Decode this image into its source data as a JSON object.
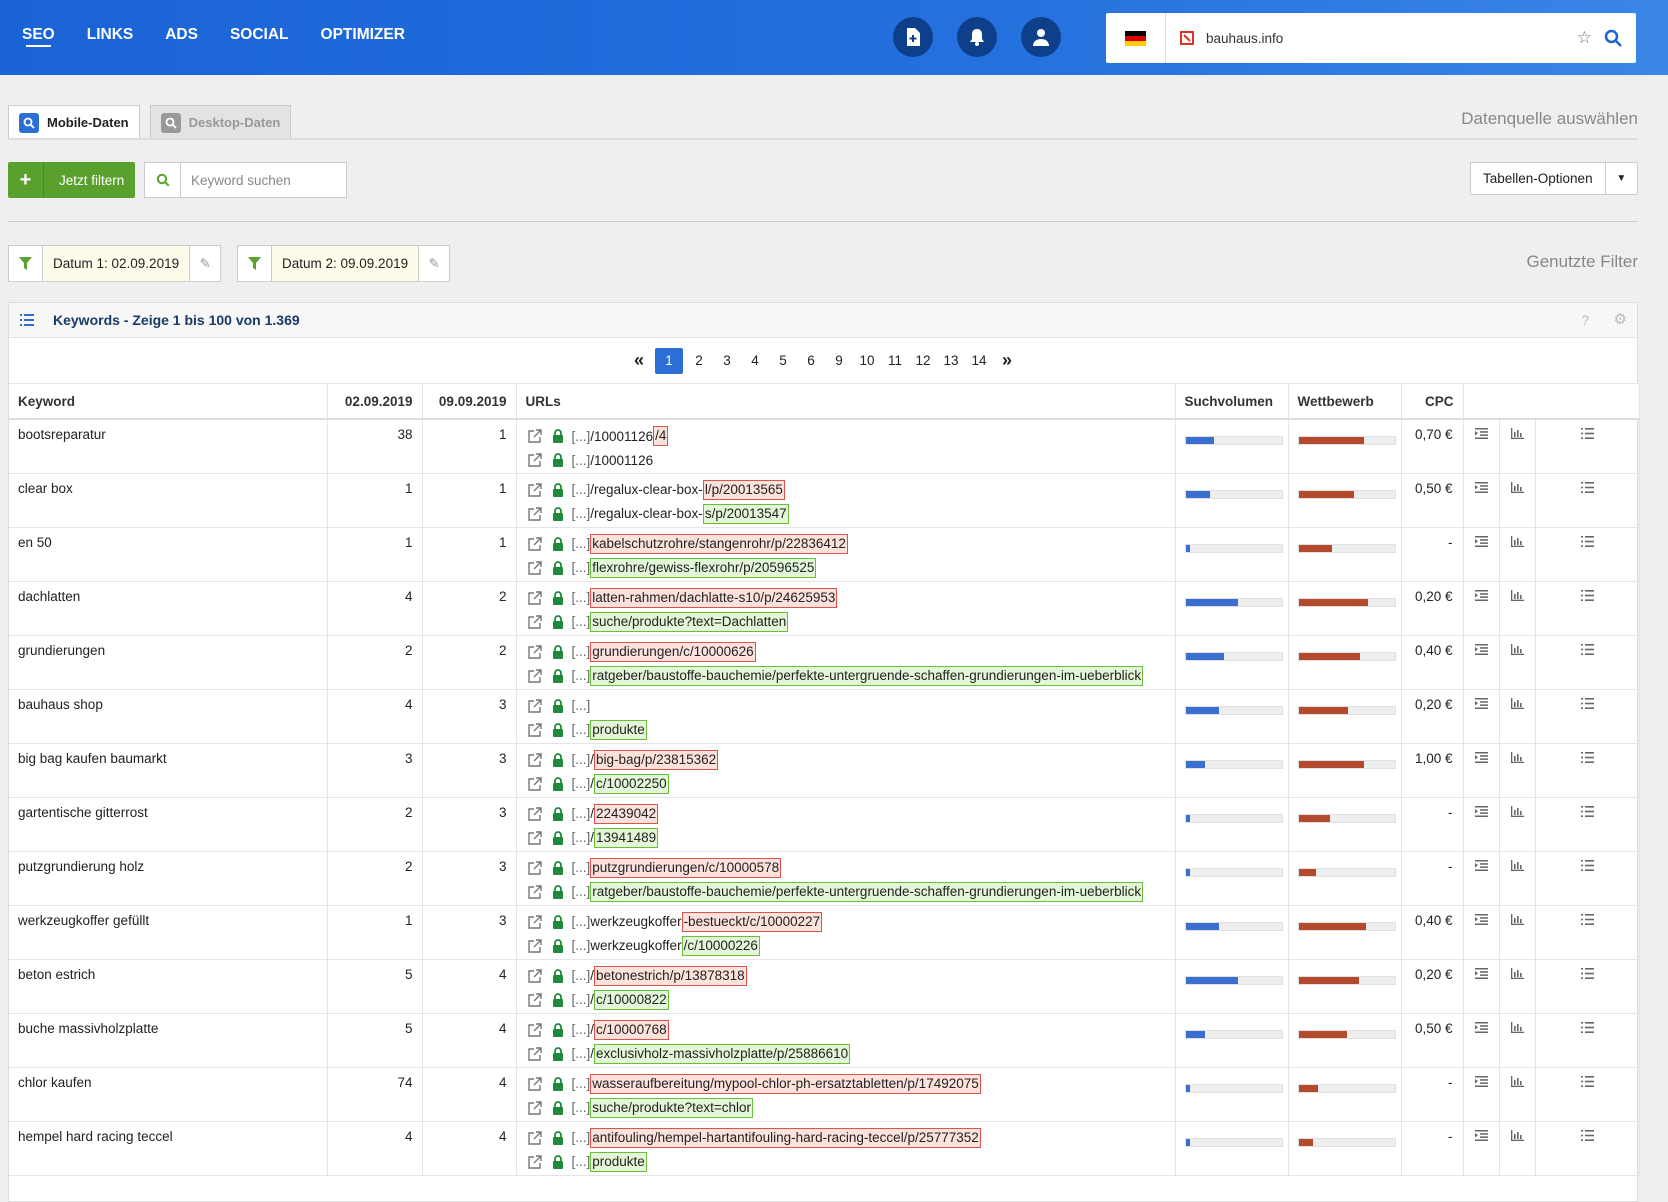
{
  "nav": {
    "items": [
      "SEO",
      "LINKS",
      "ADS",
      "SOCIAL",
      "OPTIMIZER"
    ],
    "active": "SEO"
  },
  "domain": {
    "value": "bauhaus.info",
    "flag": "germany-flag"
  },
  "tabs": [
    {
      "label": "Mobile-Daten",
      "active": true
    },
    {
      "label": "Desktop-Daten",
      "active": false
    }
  ],
  "datasource_label": "Datenquelle auswählen",
  "filter_button": "Jetzt filtern",
  "search": {
    "placeholder": "Keyword suchen"
  },
  "table_options": "Tabellen-Optionen",
  "filters": [
    "Datum 1: 02.09.2019",
    "Datum 2: 09.09.2019"
  ],
  "used_filters_label": "Genutzte Filter",
  "panel_title": "Keywords - Zeige 1 bis 100 von 1.369",
  "pagination": {
    "pages": [
      "1",
      "2",
      "3",
      "4",
      "5",
      "6",
      "9",
      "10",
      "11",
      "12",
      "13",
      "14"
    ],
    "current": "1",
    "prev": "«",
    "next": "»"
  },
  "columns": [
    "Keyword",
    "02.09.2019",
    "09.09.2019",
    "URLs",
    "Suchvolumen",
    "Wettbewerb",
    "CPC"
  ],
  "colors": {
    "accent": "#2b6fd6",
    "green": "#5aa02c",
    "removed": "#d9534f",
    "added": "#6bbd3c",
    "volume_bar": "#3a6fd0",
    "competition_bar": "#b34a2e"
  },
  "rows": [
    {
      "keyword": "bootsreparatur",
      "d1": "38",
      "d2": "1",
      "urls": [
        {
          "prefix": "[...]",
          "base": "/10001126",
          "diff": "/4",
          "type": "r"
        },
        {
          "prefix": "[...]",
          "base": "/10001126",
          "diff": "",
          "type": ""
        }
      ],
      "volume": 0.3,
      "competition": 0.68,
      "cpc": "0,70 €"
    },
    {
      "keyword": "clear box",
      "d1": "1",
      "d2": "1",
      "urls": [
        {
          "prefix": "[...]",
          "base": "/regalux-clear-box-",
          "diff": "l/p/20013565",
          "type": "r"
        },
        {
          "prefix": "[...]",
          "base": "/regalux-clear-box-",
          "diff": "s/p/20013547",
          "type": "g"
        }
      ],
      "volume": 0.25,
      "competition": 0.58,
      "cpc": "0,50 €"
    },
    {
      "keyword": "en 50",
      "d1": "1",
      "d2": "1",
      "urls": [
        {
          "prefix": "[...]",
          "base": "",
          "diff": "kabelschutzrohre/stangenrohr/p/22836412",
          "type": "r"
        },
        {
          "prefix": "[...]",
          "base": "",
          "diff": "flexrohre/gewiss-flexrohr/p/20596525",
          "type": "g"
        }
      ],
      "volume": 0.05,
      "competition": 0.35,
      "cpc": "-"
    },
    {
      "keyword": "dachlatten",
      "d1": "4",
      "d2": "2",
      "urls": [
        {
          "prefix": "[...]",
          "base": "",
          "diff": "latten-rahmen/dachlatte-s10/p/24625953",
          "type": "r"
        },
        {
          "prefix": "[...]",
          "base": "",
          "diff": "suche/produkte?text=Dachlatten",
          "type": "g"
        }
      ],
      "volume": 0.55,
      "competition": 0.72,
      "cpc": "0,20 €"
    },
    {
      "keyword": "grundierungen",
      "d1": "2",
      "d2": "2",
      "urls": [
        {
          "prefix": "[...]",
          "base": "",
          "diff": "grundierungen/c/10000626",
          "type": "r"
        },
        {
          "prefix": "[...]",
          "base": "",
          "diff": "ratgeber/baustoffe-bauchemie/perfekte-untergruende-schaffen-grundierungen-im-ueberblick",
          "type": "g"
        }
      ],
      "volume": 0.4,
      "competition": 0.64,
      "cpc": "0,40 €"
    },
    {
      "keyword": "bauhaus shop",
      "d1": "4",
      "d2": "3",
      "urls": [
        {
          "prefix": "[...]",
          "base": "",
          "diff": "",
          "type": ""
        },
        {
          "prefix": "[...]",
          "base": "",
          "diff": "produkte",
          "type": "g"
        }
      ],
      "volume": 0.35,
      "competition": 0.52,
      "cpc": "0,20 €"
    },
    {
      "keyword": "big bag kaufen baumarkt",
      "d1": "3",
      "d2": "3",
      "urls": [
        {
          "prefix": "[...]",
          "base": "/",
          "diff": "big-bag/p/23815362",
          "type": "r"
        },
        {
          "prefix": "[...]",
          "base": "/",
          "diff": "c/10002250",
          "type": "g"
        }
      ],
      "volume": 0.2,
      "competition": 0.68,
      "cpc": "1,00 €"
    },
    {
      "keyword": "gartentische gitterrost",
      "d1": "2",
      "d2": "3",
      "urls": [
        {
          "prefix": "[...]",
          "base": "/",
          "diff": "22439042",
          "type": "r"
        },
        {
          "prefix": "[...]",
          "base": "/",
          "diff": "13941489",
          "type": "g"
        }
      ],
      "volume": 0.05,
      "competition": 0.33,
      "cpc": "-"
    },
    {
      "keyword": "putzgrundierung holz",
      "d1": "2",
      "d2": "3",
      "urls": [
        {
          "prefix": "[...]",
          "base": "",
          "diff": "putzgrundierungen/c/10000578",
          "type": "r"
        },
        {
          "prefix": "[...]",
          "base": "",
          "diff": "ratgeber/baustoffe-bauchemie/perfekte-untergruende-schaffen-grundierungen-im-ueberblick",
          "type": "g"
        }
      ],
      "volume": 0.05,
      "competition": 0.18,
      "cpc": "-"
    },
    {
      "keyword": "werkzeugkoffer gefüllt",
      "d1": "1",
      "d2": "3",
      "urls": [
        {
          "prefix": "[...]",
          "base": "werkzeugkoffer",
          "diff": "-bestueckt/c/10000227",
          "type": "r"
        },
        {
          "prefix": "[...]",
          "base": "werkzeugkoffer",
          "diff": "/c/10000226",
          "type": "g"
        }
      ],
      "volume": 0.35,
      "competition": 0.7,
      "cpc": "0,40 €"
    },
    {
      "keyword": "beton estrich",
      "d1": "5",
      "d2": "4",
      "urls": [
        {
          "prefix": "[...]",
          "base": "/",
          "diff": "betonestrich/p/13878318",
          "type": "r"
        },
        {
          "prefix": "[...]",
          "base": "/",
          "diff": "c/10000822",
          "type": "g"
        }
      ],
      "volume": 0.55,
      "competition": 0.63,
      "cpc": "0,20 €"
    },
    {
      "keyword": "buche massivholzplatte",
      "d1": "5",
      "d2": "4",
      "urls": [
        {
          "prefix": "[...]",
          "base": "/",
          "diff": "c/10000768",
          "type": "r"
        },
        {
          "prefix": "[...]",
          "base": "/",
          "diff": "exclusivholz-massivholzplatte/p/25886610",
          "type": "g"
        }
      ],
      "volume": 0.2,
      "competition": 0.5,
      "cpc": "0,50 €"
    },
    {
      "keyword": "chlor kaufen",
      "d1": "74",
      "d2": "4",
      "urls": [
        {
          "prefix": "[...]",
          "base": "",
          "diff": "wasseraufbereitung/mypool-chlor-ph-ersatztabletten/p/17492075",
          "type": "r"
        },
        {
          "prefix": "[...]",
          "base": "",
          "diff": "suche/produkte?text=chlor",
          "type": "g"
        }
      ],
      "volume": 0.05,
      "competition": 0.2,
      "cpc": "-"
    },
    {
      "keyword": "hempel hard racing teccel",
      "d1": "4",
      "d2": "4",
      "urls": [
        {
          "prefix": "[...]",
          "base": "",
          "diff": "antifouling/hempel-hartantifouling-hard-racing-teccel/p/25777352",
          "type": "r"
        },
        {
          "prefix": "[...]",
          "base": "",
          "diff": "produkte",
          "type": "g"
        }
      ],
      "volume": 0.05,
      "competition": 0.15,
      "cpc": "-"
    }
  ]
}
